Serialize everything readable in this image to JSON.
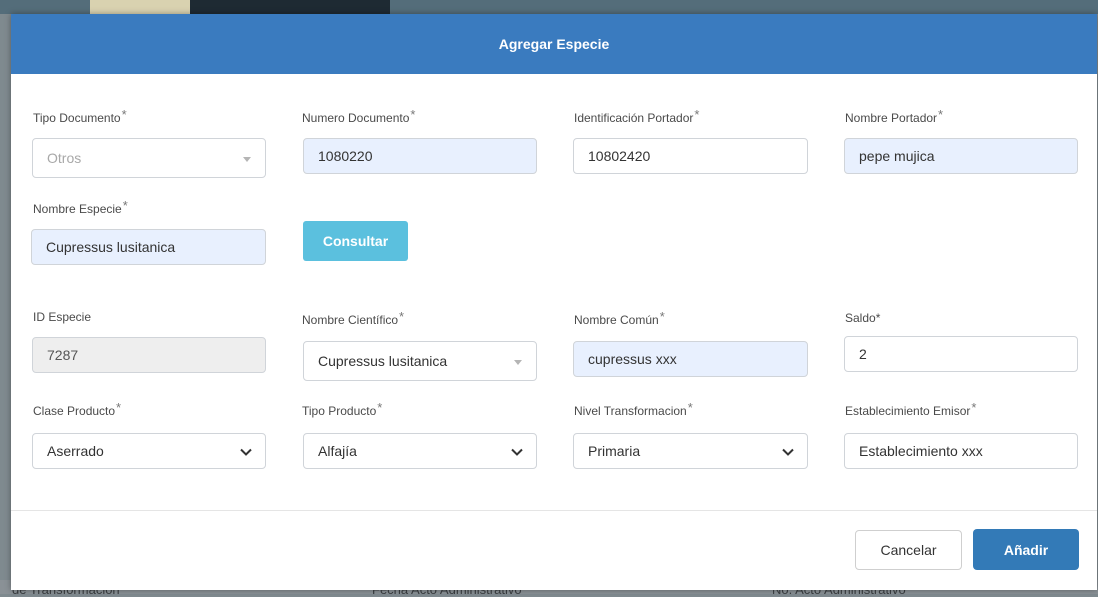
{
  "modal": {
    "title": "Agregar Especie",
    "required_mark": "*",
    "fields": {
      "tipo_documento": {
        "label": "Tipo Documento",
        "value": "Otros"
      },
      "numero_documento": {
        "label": "Numero Documento",
        "value": "1080220"
      },
      "identificacion_portador": {
        "label": "Identificación Portador",
        "value": "10802420"
      },
      "nombre_portador": {
        "label": "Nombre Portador",
        "value": "pepe mujica"
      },
      "nombre_especie": {
        "label": "Nombre Especie",
        "value": "Cupressus lusitanica"
      },
      "id_especie": {
        "label": "ID Especie",
        "value": "7287"
      },
      "nombre_cientifico": {
        "label": "Nombre Científico",
        "value": "Cupressus lusitanica"
      },
      "nombre_comun": {
        "label": "Nombre Común",
        "value": "cupressus xxx"
      },
      "saldo": {
        "label": "Saldo*",
        "value": "2"
      },
      "clase_producto": {
        "label": "Clase Producto",
        "value": "Aserrado"
      },
      "tipo_producto": {
        "label": "Tipo Producto",
        "value": "Alfajía"
      },
      "nivel_transformacion": {
        "label": "Nivel Transformacion",
        "value": "Primaria"
      },
      "establecimiento_emisor": {
        "label": "Establecimiento Emisor",
        "value": "Establecimiento xxx"
      }
    },
    "buttons": {
      "consultar": "Consultar",
      "cancelar": "Cancelar",
      "anadir": "Añadir"
    }
  },
  "background": {
    "footer_texts": [
      "de Transformación",
      "Fecha Acto Administrativo",
      "No. Acto Administrativo"
    ]
  },
  "colors": {
    "header": "#3a7bbf",
    "consultar": "#5bc0de",
    "primary": "#337ab7",
    "autofill": "#e8f0fe"
  }
}
